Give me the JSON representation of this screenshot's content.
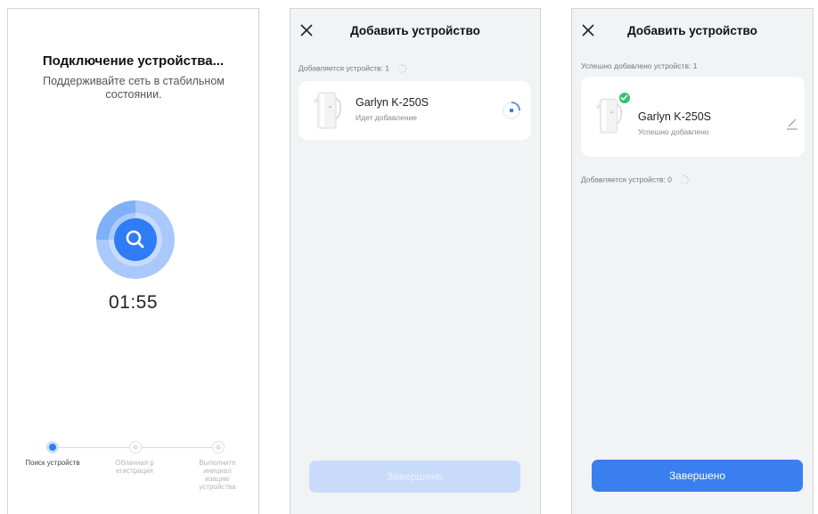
{
  "screen1": {
    "title": "Подключение устройства...",
    "subtitle": "Поддерживайте сеть в стабильном состоянии.",
    "icon": "search-icon",
    "timer": "01:55",
    "steps": [
      {
        "label": "Поиск устройств",
        "state": "active"
      },
      {
        "label": "Облачная р егистрация",
        "state": "inactive"
      },
      {
        "label": "Выполните инициал изацию устройства",
        "state": "inactive"
      }
    ],
    "accent": "#2f7cf6"
  },
  "screen2": {
    "title": "Добавить устройство",
    "adding_label": "Добавляется устройств: 1",
    "device": {
      "name": "Garlyn K-250S",
      "status": "Идет добавление"
    },
    "done_button": "Завершено",
    "button_state": "disabled"
  },
  "screen3": {
    "title": "Добавить устройство",
    "added_label": "Успешно добавлено устройств: 1",
    "device": {
      "name": "Garlyn K-250S",
      "status": "Успешно добавлено"
    },
    "adding_label": "Добавляется устройств: 0",
    "done_button": "Завершено",
    "button_state": "enabled",
    "success_color": "#33c46a",
    "button_color": "#3a7ff0"
  }
}
